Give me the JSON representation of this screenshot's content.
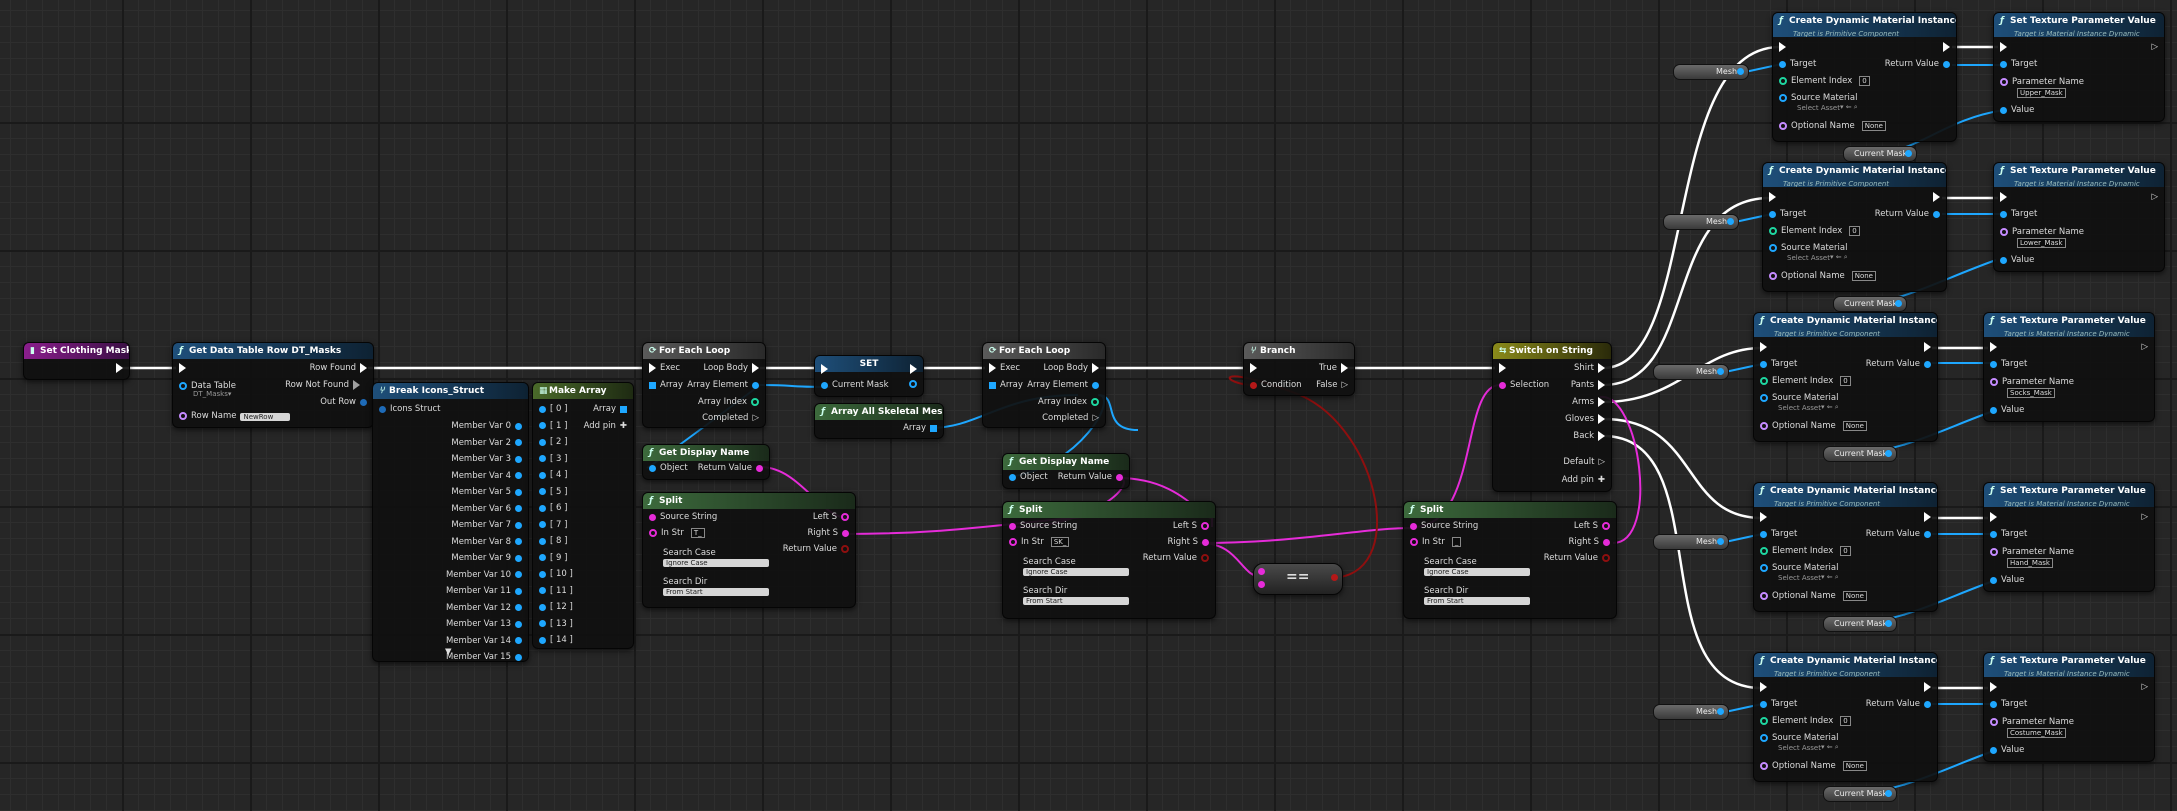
{
  "colors": {
    "exec": "#ffffff",
    "object": "#1ea7ff",
    "string": "#e62bd9",
    "bool": "#8e0f0f",
    "int": "#1ed6a0",
    "name": "#c58bff",
    "struct": "#1e6bb8",
    "array": "#1ea7ff"
  },
  "set_clothing_mask": {
    "title": "Set Clothing Mask"
  },
  "get_data_table_row": {
    "title": "Get Data Table Row DT_Masks",
    "row_found": "Row Found",
    "row_not_found": "Row Not Found",
    "out_row": "Out Row",
    "data_table": "Data Table",
    "data_table_value": "DT_Masks",
    "row_name": "Row Name",
    "row_name_value": "NewRow"
  },
  "break_struct": {
    "title": "Break Icons_Struct",
    "input": "Icons Struct",
    "members": [
      "Member Var 0",
      "Member Var 2",
      "Member Var 3",
      "Member Var 4",
      "Member Var 5",
      "Member Var 6",
      "Member Var 7",
      "Member Var 8",
      "Member Var 9",
      "Member Var 10",
      "Member Var 11",
      "Member Var 12",
      "Member Var 13",
      "Member Var 14",
      "Member Var 15"
    ]
  },
  "make_array": {
    "title": "Make Array",
    "array": "Array",
    "add_pin": "Add pin",
    "pins": [
      "[ 0 ]",
      "[ 1 ]",
      "[ 2 ]",
      "[ 3 ]",
      "[ 4 ]",
      "[ 5 ]",
      "[ 6 ]",
      "[ 7 ]",
      "[ 8 ]",
      "[ 9 ]",
      "[ 10 ]",
      "[ 11 ]",
      "[ 12 ]",
      "[ 13 ]",
      "[ 14 ]"
    ]
  },
  "foreach1": {
    "title": "For Each Loop",
    "exec": "Exec",
    "array": "Array",
    "loop_body": "Loop Body",
    "array_element": "Array Element",
    "array_index": "Array Index",
    "completed": "Completed"
  },
  "set_node": {
    "title": "SET",
    "current_mask": "Current Mask"
  },
  "array_all_meshes": {
    "title": "Array All Skeletal Meshes",
    "array": "Array"
  },
  "get_display_name1": {
    "title": "Get Display Name",
    "object": "Object",
    "return_value": "Return Value"
  },
  "split1": {
    "title": "Split",
    "source_string": "Source String",
    "in_str": "In Str",
    "in_str_value": "T_",
    "left_s": "Left S",
    "right_s": "Right S",
    "return_value": "Return Value",
    "search_case": "Search Case",
    "search_case_value": "Ignore Case",
    "search_dir": "Search Dir",
    "search_dir_value": "From Start"
  },
  "foreach2": {
    "title": "For Each Loop",
    "exec": "Exec",
    "array": "Array",
    "loop_body": "Loop Body",
    "array_element": "Array Element",
    "array_index": "Array Index",
    "completed": "Completed"
  },
  "get_display_name2": {
    "title": "Get Display Name",
    "object": "Object",
    "return_value": "Return Value"
  },
  "split2": {
    "title": "Split",
    "source_string": "Source String",
    "in_str": "In Str",
    "in_str_value": "SK_",
    "left_s": "Left S",
    "right_s": "Right S",
    "return_value": "Return Value",
    "search_case": "Search Case",
    "search_case_value": "Ignore Case",
    "search_dir": "Search Dir",
    "search_dir_value": "From Start"
  },
  "equals_node": {
    "title": "=="
  },
  "branch": {
    "title": "Branch",
    "condition": "Condition",
    "true_label": "True",
    "false_label": "False"
  },
  "split3": {
    "title": "Split",
    "source_string": "Source String",
    "in_str": "In Str",
    "in_str_value": "_",
    "left_s": "Left S",
    "right_s": "Right S",
    "return_value": "Return Value",
    "search_case": "Search Case",
    "search_case_value": "Ignore Case",
    "search_dir": "Search Dir",
    "search_dir_value": "From Start"
  },
  "switch_string": {
    "title": "Switch on String",
    "selection": "Selection",
    "outputs": [
      "Shirt",
      "Pants",
      "Arms",
      "Gloves",
      "Back",
      "Default"
    ],
    "add_pin": "Add pin"
  },
  "cdmi": {
    "title": "Create Dynamic Material Instance",
    "subtitle": "Target is Primitive Component",
    "target": "Target",
    "return_value": "Return Value",
    "element_index": "Element Index",
    "element_index_value": "0",
    "source_material": "Source Material",
    "source_material_value": "Select Asset",
    "optional_name": "Optional Name",
    "optional_name_value": "None"
  },
  "stpv": {
    "title": "Set Texture Parameter Value",
    "subtitle": "Target is Material Instance Dynamic",
    "target": "Target",
    "parameter_name": "Parameter Name",
    "value": "Value"
  },
  "param_names": [
    "Upper_Mask",
    "Lower_Mask",
    "Socks_Mask",
    "Hand_Mask",
    "Costume_Mask"
  ],
  "reroutes": {
    "mesh": "Mesh",
    "current_mask": "Current Mask"
  }
}
